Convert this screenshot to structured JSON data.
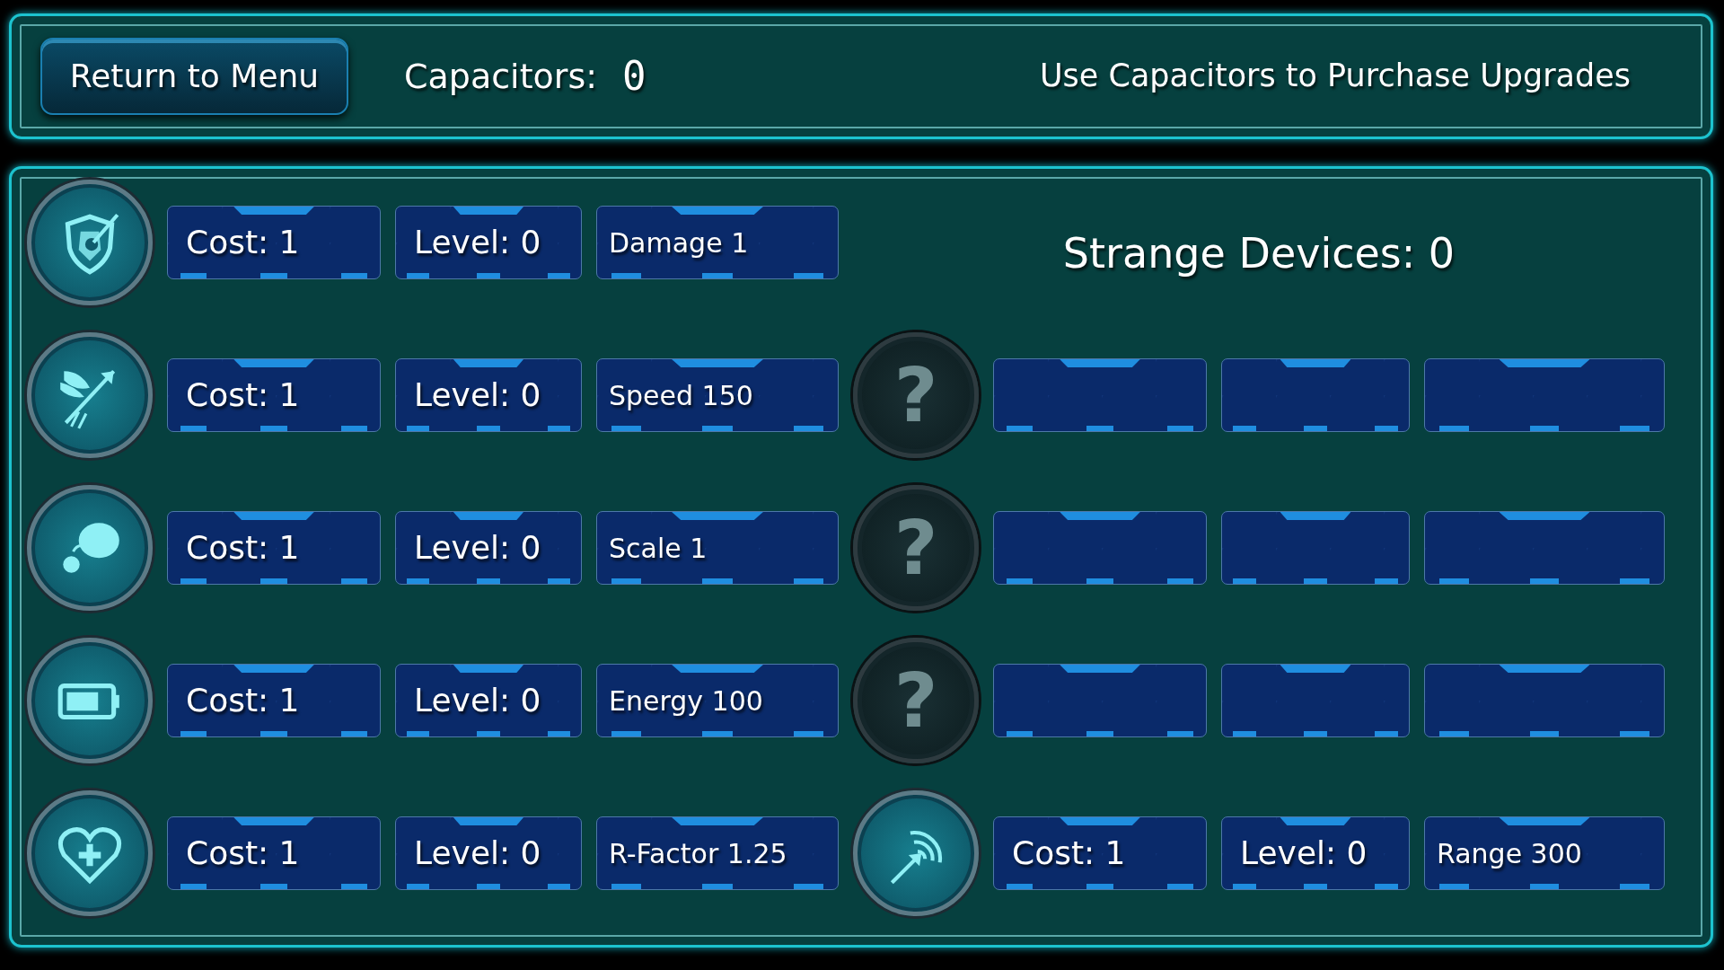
{
  "header": {
    "menu_button": "Return to Menu",
    "capacitors_label": "Capacitors:",
    "capacitors_value": "0",
    "hint": "Use Capacitors to Purchase Upgrades"
  },
  "strange_devices": "Strange Devices: 0",
  "upgrades": [
    {
      "cost": "Cost: 1",
      "level": "Level: 0",
      "stat": "Damage 1"
    },
    {
      "cost": "Cost: 1",
      "level": "Level: 0",
      "stat": "Speed 150"
    },
    {
      "cost": "Cost: 1",
      "level": "Level: 0",
      "stat": "Scale 1"
    },
    {
      "cost": "Cost: 1",
      "level": "Level: 0",
      "stat": "Energy 100"
    },
    {
      "cost": "Cost: 1",
      "level": "Level: 0",
      "stat": "R-Factor 1.25"
    }
  ],
  "devices": [
    {
      "kind": "locked",
      "symbol": "?"
    },
    {
      "kind": "locked",
      "symbol": "?"
    },
    {
      "kind": "locked",
      "symbol": "?"
    },
    {
      "kind": "upgrade",
      "cost": "Cost: 1",
      "level": "Level: 0",
      "stat": "Range 300"
    }
  ]
}
